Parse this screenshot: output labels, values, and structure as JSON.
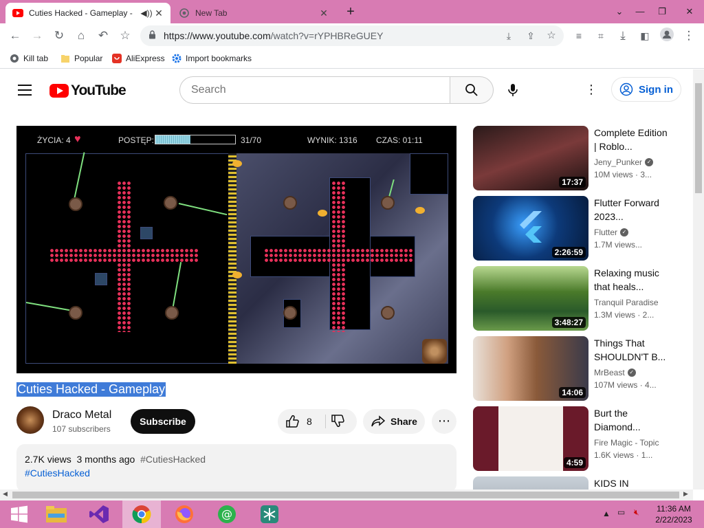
{
  "browser": {
    "tabs": [
      {
        "title": "Cuties Hacked - Gameplay - ",
        "active": true,
        "icon": "youtube-icon",
        "audio": true
      },
      {
        "title": "New Tab",
        "active": false,
        "icon": "chrome-newtab-icon"
      }
    ],
    "url_host": "https://www.youtube.com",
    "url_path": "/watch?v=rYPHBReGUEY",
    "bookmarks": [
      {
        "label": "Kill tab",
        "icon": "kill-tab-icon"
      },
      {
        "label": "Popular",
        "icon": "folder-icon"
      },
      {
        "label": "AliExpress",
        "icon": "aliexpress-icon"
      },
      {
        "label": "Import bookmarks",
        "icon": "gear-icon"
      }
    ]
  },
  "header": {
    "logo_text": "YouTube",
    "search_placeholder": "Search",
    "signin_label": "Sign in"
  },
  "player": {
    "lives_label": "ŻYCIA:",
    "lives_value": "4",
    "progress_label": "POSTĘP:",
    "progress_text": "31/70",
    "progress_fraction": 0.443,
    "score_label": "WYNIK: 1316",
    "time_label": "CZAS: 01:11"
  },
  "video": {
    "title": "Cuties Hacked - Gameplay",
    "channel": "Draco Metal",
    "subscribers": "107 subscribers",
    "subscribe_label": "Subscribe",
    "likes": "8",
    "share_label": "Share",
    "views": "2.7K views",
    "age": "3 months ago",
    "hashtag": "#CutiesHacked",
    "desc_hashtag": "#CutiesHacked"
  },
  "recommendations": [
    {
      "title": "Complete Edition | Roblo...",
      "channel": "Jeny_Punker",
      "verified": true,
      "meta": "10M views · 3...",
      "duration": "17:37",
      "thumb_color": "#3a2a2a"
    },
    {
      "title": "Flutter Forward 2023...",
      "channel": "Flutter",
      "verified": true,
      "meta": "1.7M views...",
      "duration": "2:26:59",
      "thumb_color": "#0b2a5a"
    },
    {
      "title": "Relaxing music that heals...",
      "channel": "Tranquil Paradise",
      "verified": false,
      "meta": "1.3M views · 2...",
      "duration": "3:48:27",
      "thumb_color": "#4d7a2a"
    },
    {
      "title": "Things That SHOULDN'T B...",
      "channel": "MrBeast",
      "verified": true,
      "meta": "107M views · 4...",
      "duration": "14:06",
      "thumb_color": "#c8b8a8"
    },
    {
      "title": "Burt the Diamond...",
      "channel": "Fire Magic - Topic",
      "verified": false,
      "meta": "1.6K views · 1...",
      "duration": "4:59",
      "thumb_color": "#6a1a2a"
    },
    {
      "title": "KIDS IN",
      "channel": "",
      "verified": false,
      "meta": "",
      "duration": "",
      "thumb_color": "#a0a8b0"
    }
  ],
  "taskbar": {
    "apps": [
      {
        "name": "windows-start-icon"
      },
      {
        "name": "file-explorer-icon"
      },
      {
        "name": "visual-studio-icon"
      },
      {
        "name": "chrome-icon"
      },
      {
        "name": "firefox-icon"
      },
      {
        "name": "mail-app-icon"
      },
      {
        "name": "snowflake-app-icon"
      }
    ],
    "time": "11:36 AM",
    "date": "2/22/2023"
  }
}
